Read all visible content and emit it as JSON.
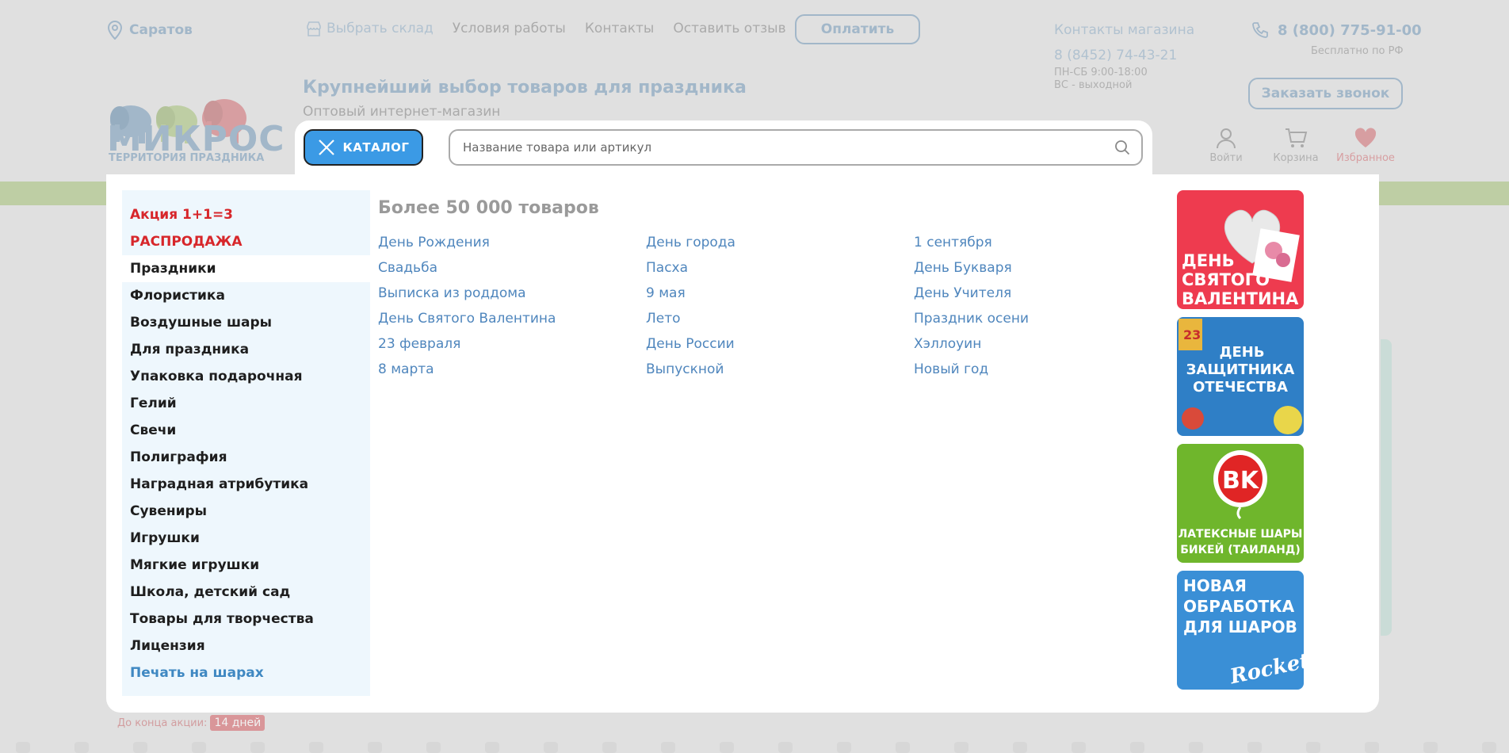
{
  "header": {
    "city": "Саратов",
    "nav": [
      "Выбрать склад",
      "Условия работы",
      "Контакты",
      "Оставить отзыв"
    ],
    "pay_label": "Оплатить",
    "store_contacts_title": "Контакты магазина",
    "store_phone": "8 (8452) 74-43-21",
    "store_hours": [
      "ПН-СБ 9:00-18:00",
      "ВС - выходной"
    ],
    "main_phone": "8 (800) 775-91-00",
    "free_note": "Бесплатно по РФ",
    "callback_label": "Заказать звонок"
  },
  "brand": {
    "name": "МИКРОС",
    "subtitle": "ТЕРРИТОРИЯ ПРАЗДНИКА",
    "tagline": "Крупнейший выбор товаров для праздника",
    "subtagline": "Оптовый интернет-магазин"
  },
  "search": {
    "catalog_label": "КАТАЛОГ",
    "placeholder": "Название товара или артикул"
  },
  "user": {
    "login": "Войти",
    "cart": "Корзина",
    "favorites": "Избранное"
  },
  "menu": {
    "categories": [
      "Акция 1+1=3",
      "РАСПРОДАЖА",
      "Праздники",
      "Флористика",
      "Воздушные шары",
      "Для праздника",
      "Упаковка подарочная",
      "Гелий",
      "Свечи",
      "Полиграфия",
      "Наградная атрибутика",
      "Сувениры",
      "Игрушки",
      "Мягкие игрушки",
      "Школа, детский сад",
      "Товары для творчества",
      "Лицензия",
      "Печать на шарах"
    ],
    "title": "Более 50 000 товаров",
    "columns": [
      [
        "День Рождения",
        "Свадьба",
        "Выписка из роддома",
        "День Святого Валентина",
        "23 февраля",
        "8 марта"
      ],
      [
        "День города",
        "Пасха",
        "9 мая",
        "Лето",
        "День России",
        "Выпускной"
      ],
      [
        "1 сентября",
        "День Букваря",
        "День Учителя",
        "Праздник осени",
        "Хэллоуин",
        "Новый год"
      ]
    ]
  },
  "banners": [
    {
      "text": "ДЕНЬ\nСВЯТОГО\nВАЛЕНТИНА",
      "color": "#ee3b4f"
    },
    {
      "text": "ДЕНЬ\nЗАЩИТНИКА\nОТЕЧЕСТВА",
      "color": "#2f7fc6"
    },
    {
      "text": "ЛАТЕКСНЫЕ ШАРЫ\nБИКЕЙ (ТАИЛАНД)",
      "color": "#6fb62c"
    },
    {
      "text": "НОВАЯ\nОБРАБОТКА\nДЛЯ ШАРОВ",
      "color": "#3a8fd6"
    }
  ],
  "banner_extras": {
    "bk_logo": "BK",
    "rocket": "Rocket"
  },
  "promo": {
    "label": "До конца акции:",
    "badge": "14 дней"
  }
}
